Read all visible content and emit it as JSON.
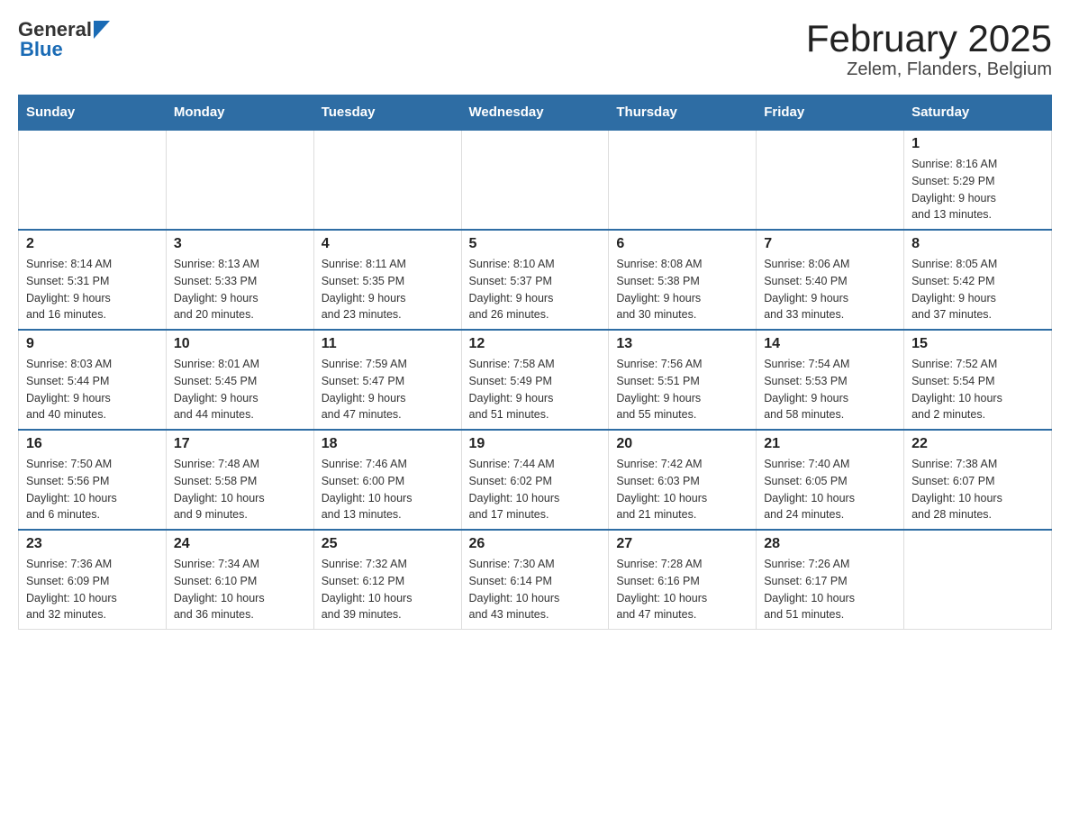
{
  "header": {
    "logo": {
      "general": "General",
      "blue": "Blue",
      "triangle_color": "#1a6bb5"
    },
    "title": "February 2025",
    "subtitle": "Zelem, Flanders, Belgium"
  },
  "calendar": {
    "days_of_week": [
      "Sunday",
      "Monday",
      "Tuesday",
      "Wednesday",
      "Thursday",
      "Friday",
      "Saturday"
    ],
    "weeks": [
      {
        "days": [
          {
            "number": "",
            "info": ""
          },
          {
            "number": "",
            "info": ""
          },
          {
            "number": "",
            "info": ""
          },
          {
            "number": "",
            "info": ""
          },
          {
            "number": "",
            "info": ""
          },
          {
            "number": "",
            "info": ""
          },
          {
            "number": "1",
            "info": "Sunrise: 8:16 AM\nSunset: 5:29 PM\nDaylight: 9 hours\nand 13 minutes."
          }
        ]
      },
      {
        "days": [
          {
            "number": "2",
            "info": "Sunrise: 8:14 AM\nSunset: 5:31 PM\nDaylight: 9 hours\nand 16 minutes."
          },
          {
            "number": "3",
            "info": "Sunrise: 8:13 AM\nSunset: 5:33 PM\nDaylight: 9 hours\nand 20 minutes."
          },
          {
            "number": "4",
            "info": "Sunrise: 8:11 AM\nSunset: 5:35 PM\nDaylight: 9 hours\nand 23 minutes."
          },
          {
            "number": "5",
            "info": "Sunrise: 8:10 AM\nSunset: 5:37 PM\nDaylight: 9 hours\nand 26 minutes."
          },
          {
            "number": "6",
            "info": "Sunrise: 8:08 AM\nSunset: 5:38 PM\nDaylight: 9 hours\nand 30 minutes."
          },
          {
            "number": "7",
            "info": "Sunrise: 8:06 AM\nSunset: 5:40 PM\nDaylight: 9 hours\nand 33 minutes."
          },
          {
            "number": "8",
            "info": "Sunrise: 8:05 AM\nSunset: 5:42 PM\nDaylight: 9 hours\nand 37 minutes."
          }
        ]
      },
      {
        "days": [
          {
            "number": "9",
            "info": "Sunrise: 8:03 AM\nSunset: 5:44 PM\nDaylight: 9 hours\nand 40 minutes."
          },
          {
            "number": "10",
            "info": "Sunrise: 8:01 AM\nSunset: 5:45 PM\nDaylight: 9 hours\nand 44 minutes."
          },
          {
            "number": "11",
            "info": "Sunrise: 7:59 AM\nSunset: 5:47 PM\nDaylight: 9 hours\nand 47 minutes."
          },
          {
            "number": "12",
            "info": "Sunrise: 7:58 AM\nSunset: 5:49 PM\nDaylight: 9 hours\nand 51 minutes."
          },
          {
            "number": "13",
            "info": "Sunrise: 7:56 AM\nSunset: 5:51 PM\nDaylight: 9 hours\nand 55 minutes."
          },
          {
            "number": "14",
            "info": "Sunrise: 7:54 AM\nSunset: 5:53 PM\nDaylight: 9 hours\nand 58 minutes."
          },
          {
            "number": "15",
            "info": "Sunrise: 7:52 AM\nSunset: 5:54 PM\nDaylight: 10 hours\nand 2 minutes."
          }
        ]
      },
      {
        "days": [
          {
            "number": "16",
            "info": "Sunrise: 7:50 AM\nSunset: 5:56 PM\nDaylight: 10 hours\nand 6 minutes."
          },
          {
            "number": "17",
            "info": "Sunrise: 7:48 AM\nSunset: 5:58 PM\nDaylight: 10 hours\nand 9 minutes."
          },
          {
            "number": "18",
            "info": "Sunrise: 7:46 AM\nSunset: 6:00 PM\nDaylight: 10 hours\nand 13 minutes."
          },
          {
            "number": "19",
            "info": "Sunrise: 7:44 AM\nSunset: 6:02 PM\nDaylight: 10 hours\nand 17 minutes."
          },
          {
            "number": "20",
            "info": "Sunrise: 7:42 AM\nSunset: 6:03 PM\nDaylight: 10 hours\nand 21 minutes."
          },
          {
            "number": "21",
            "info": "Sunrise: 7:40 AM\nSunset: 6:05 PM\nDaylight: 10 hours\nand 24 minutes."
          },
          {
            "number": "22",
            "info": "Sunrise: 7:38 AM\nSunset: 6:07 PM\nDaylight: 10 hours\nand 28 minutes."
          }
        ]
      },
      {
        "days": [
          {
            "number": "23",
            "info": "Sunrise: 7:36 AM\nSunset: 6:09 PM\nDaylight: 10 hours\nand 32 minutes."
          },
          {
            "number": "24",
            "info": "Sunrise: 7:34 AM\nSunset: 6:10 PM\nDaylight: 10 hours\nand 36 minutes."
          },
          {
            "number": "25",
            "info": "Sunrise: 7:32 AM\nSunset: 6:12 PM\nDaylight: 10 hours\nand 39 minutes."
          },
          {
            "number": "26",
            "info": "Sunrise: 7:30 AM\nSunset: 6:14 PM\nDaylight: 10 hours\nand 43 minutes."
          },
          {
            "number": "27",
            "info": "Sunrise: 7:28 AM\nSunset: 6:16 PM\nDaylight: 10 hours\nand 47 minutes."
          },
          {
            "number": "28",
            "info": "Sunrise: 7:26 AM\nSunset: 6:17 PM\nDaylight: 10 hours\nand 51 minutes."
          },
          {
            "number": "",
            "info": ""
          }
        ]
      }
    ]
  }
}
